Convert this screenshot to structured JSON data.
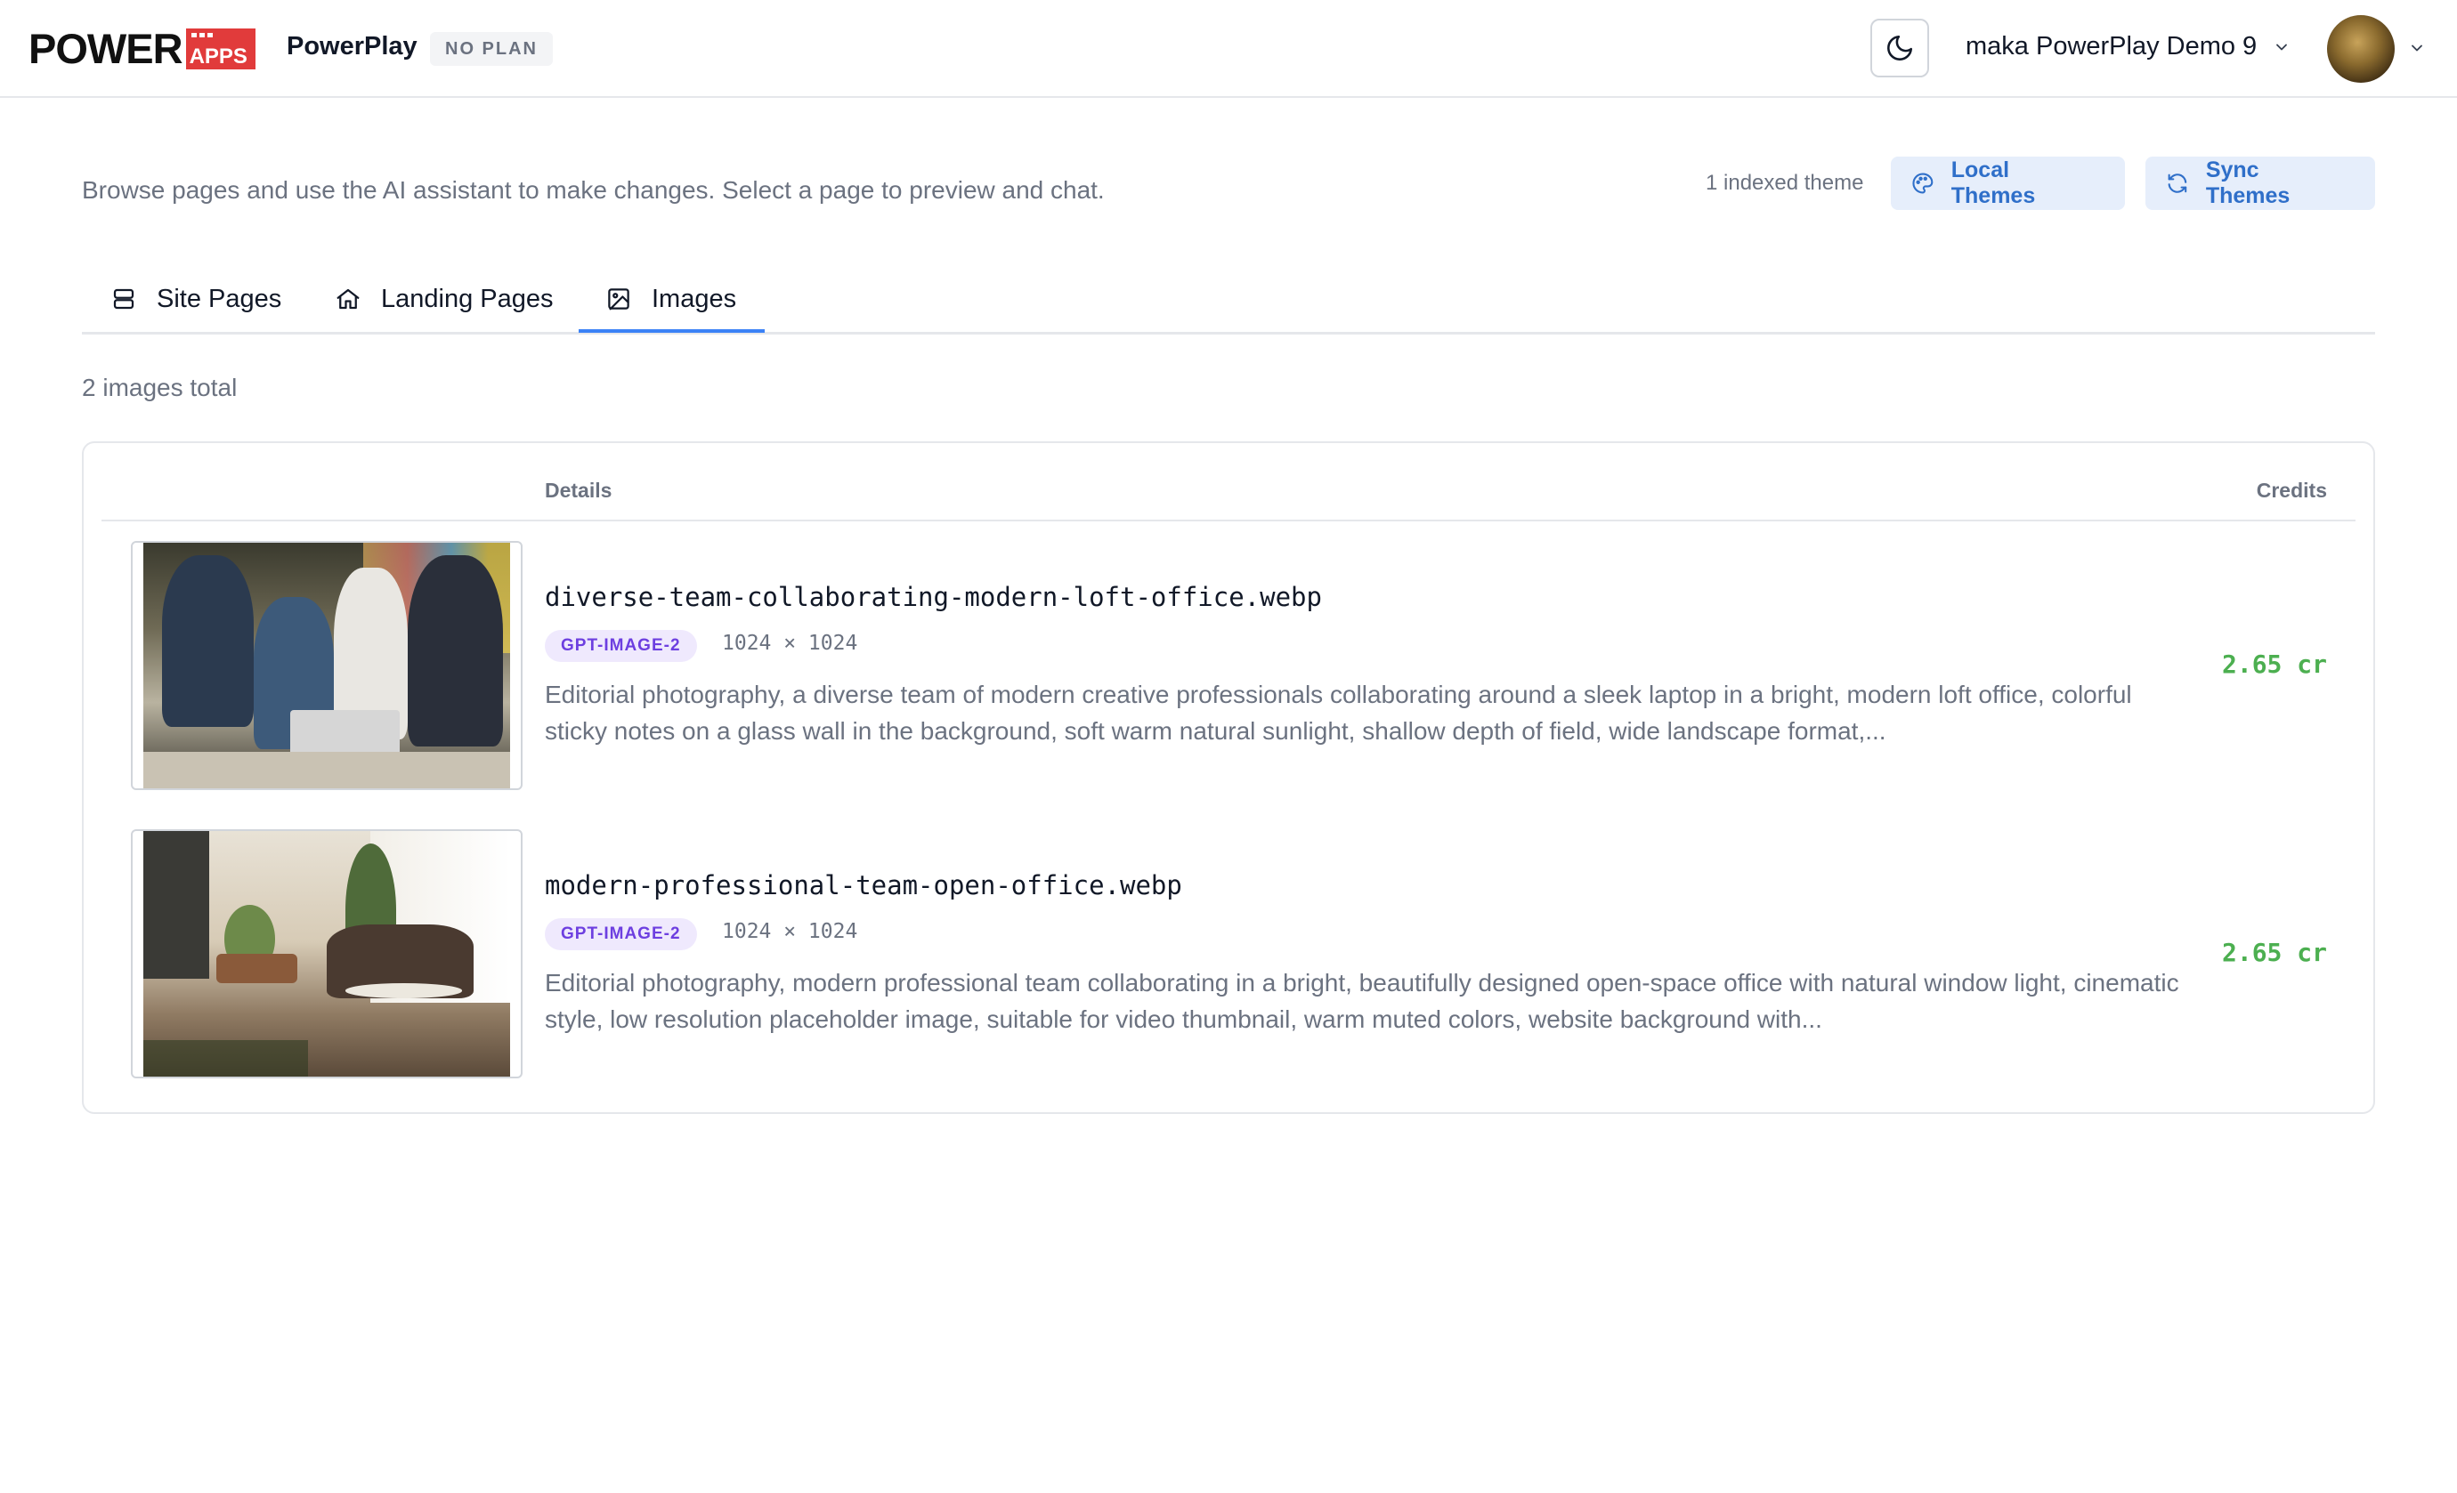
{
  "header": {
    "logo": {
      "word": "POWER",
      "badge": "APPS"
    },
    "app_name": "PowerPlay",
    "plan_badge": "NO PLAN",
    "theme_toggle_icon": "moon-icon",
    "workspace_name": "maka PowerPlay Demo 9",
    "avatar_icon": "user-avatar"
  },
  "toolbar": {
    "subtitle": "Browse pages and use the AI assistant to make changes. Select a page to preview and chat.",
    "indexed_count": "1 indexed theme",
    "local_themes_label": "Local Themes",
    "sync_themes_label": "Sync Themes",
    "accent_color": "#2f6fc9"
  },
  "tabs": [
    {
      "label": "Site Pages",
      "icon": "server-stack-icon",
      "active": false
    },
    {
      "label": "Landing Pages",
      "icon": "home-icon",
      "active": false
    },
    {
      "label": "Images",
      "icon": "image-icon",
      "active": true
    }
  ],
  "images": {
    "count_text": "2 images total",
    "columns": {
      "details": "Details",
      "credits": "Credits"
    },
    "rows": [
      {
        "filename": "diverse-team-collaborating-modern-loft-office.webp",
        "model": "GPT-IMAGE-2",
        "dimensions": "1024 × 1024",
        "description": "Editorial photography, a diverse team of modern creative professionals collaborating around a sleek laptop in a bright, modern loft office, colorful sticky notes on a glass wall in the background, soft warm natural sunlight, shallow depth of field, wide landscape format,...",
        "credits": "2.65 cr"
      },
      {
        "filename": "modern-professional-team-open-office.webp",
        "model": "GPT-IMAGE-2",
        "dimensions": "1024 × 1024",
        "description": "Editorial photography, modern professional team collaborating in a bright, beautifully designed open-space office with natural window light, cinematic style, low resolution placeholder image, suitable for video thumbnail, warm muted colors, website background with...",
        "credits": "2.65 cr"
      }
    ],
    "credits_color": "#4caf50",
    "model_badge_color": "#6d3fe0"
  }
}
